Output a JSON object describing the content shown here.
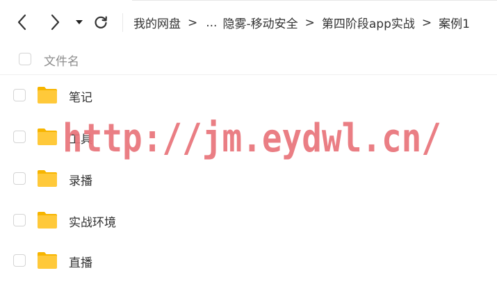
{
  "toolbar": {
    "back_icon": "chevron-left-icon",
    "forward_icon": "chevron-right-icon",
    "history_icon": "caret-down-icon",
    "refresh_icon": "refresh-icon"
  },
  "breadcrumb": {
    "items": [
      "我的网盘",
      "...",
      "隐雾-移动安全",
      "第四阶段app实战",
      "案例1"
    ],
    "separator": ">"
  },
  "list_header": {
    "column_label": "文件名"
  },
  "files": [
    {
      "name": "笔记",
      "icon": "folder-icon"
    },
    {
      "name": "工具",
      "icon": "folder-icon"
    },
    {
      "name": "录播",
      "icon": "folder-icon"
    },
    {
      "name": "实战环境",
      "icon": "folder-icon"
    },
    {
      "name": "直播",
      "icon": "folder-icon"
    }
  ],
  "watermark": {
    "text": "http://jm.eydwl.cn/",
    "color": "#e8737a"
  },
  "colors": {
    "folder_body": "#ffc93a",
    "folder_tab": "#f7b500",
    "text": "#333333",
    "muted": "#8c8c8c"
  }
}
